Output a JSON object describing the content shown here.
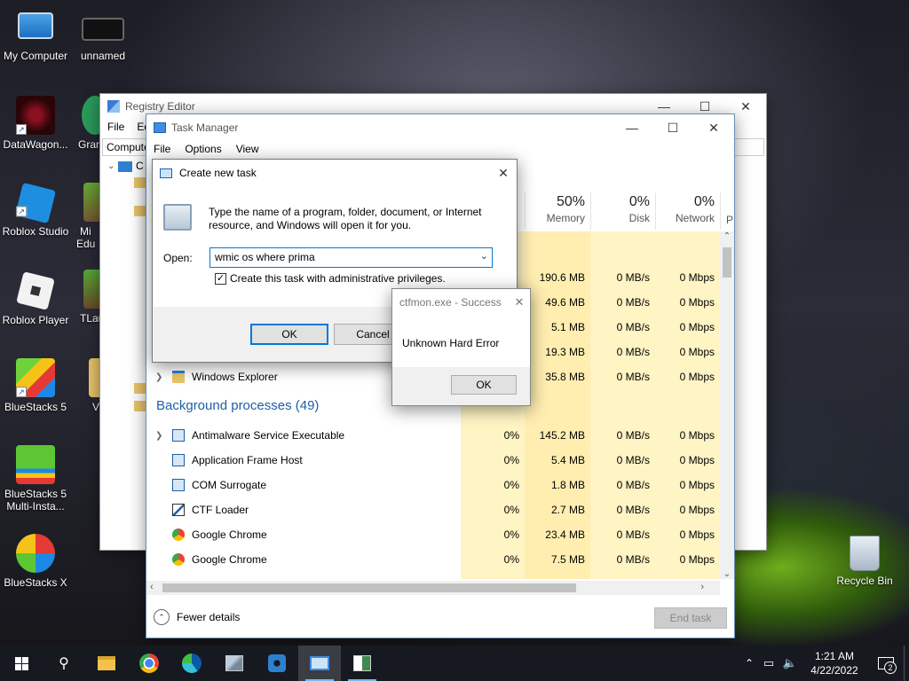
{
  "desktop": {
    "icons": [
      {
        "label": "My Computer"
      },
      {
        "label": "unnamed"
      },
      {
        "label": "DataWagon..."
      },
      {
        "label": "Grand"
      },
      {
        "label": "Roblox Studio"
      },
      {
        "label": "Mi Edu"
      },
      {
        "label": "Roblox Player"
      },
      {
        "label": "TLau"
      },
      {
        "label": "BlueStacks 5"
      },
      {
        "label": "V"
      },
      {
        "label": "BlueStacks 5 Multi-Insta..."
      },
      {
        "label": "BlueStacks X"
      },
      {
        "label": "Recycle Bin"
      }
    ]
  },
  "registry": {
    "title": "Registry Editor",
    "menu": [
      "File",
      "Ed"
    ],
    "address": "Compute",
    "tree_root": "C"
  },
  "taskmgr": {
    "title": "Task Manager",
    "menu": [
      "File",
      "Options",
      "View"
    ],
    "columns": [
      {
        "pct": "50%",
        "label": "Memory"
      },
      {
        "pct": "0%",
        "label": "Disk"
      },
      {
        "pct": "0%",
        "label": "Network"
      },
      {
        "pct": "",
        "label": "P"
      }
    ],
    "app_rows": [
      {
        "mem": "190.6 MB",
        "disk": "0 MB/s",
        "net": "0 Mbps"
      },
      {
        "mem": "49.6 MB",
        "disk": "0 MB/s",
        "net": "0 Mbps"
      },
      {
        "mem": "5.1 MB",
        "disk": "0 MB/s",
        "net": "0 Mbps"
      },
      {
        "mem": "19.3 MB",
        "disk": "0 MB/s",
        "net": "0 Mbps"
      },
      {
        "name": "Windows Explorer",
        "mem": "35.8 MB",
        "disk": "0 MB/s",
        "net": "0 Mbps"
      }
    ],
    "bg_header": "Background processes (49)",
    "bg_rows": [
      {
        "name": "Antimalware Service Executable",
        "cpu": "0%",
        "mem": "145.2 MB",
        "disk": "0 MB/s",
        "net": "0 Mbps"
      },
      {
        "name": "Application Frame Host",
        "cpu": "0%",
        "mem": "5.4 MB",
        "disk": "0 MB/s",
        "net": "0 Mbps"
      },
      {
        "name": "COM Surrogate",
        "cpu": "0%",
        "mem": "1.8 MB",
        "disk": "0 MB/s",
        "net": "0 Mbps"
      },
      {
        "name": "CTF Loader",
        "cpu": "0%",
        "mem": "2.7 MB",
        "disk": "0 MB/s",
        "net": "0 Mbps"
      },
      {
        "name": "Google Chrome",
        "cpu": "0%",
        "mem": "23.4 MB",
        "disk": "0 MB/s",
        "net": "0 Mbps"
      },
      {
        "name": "Google Chrome",
        "cpu": "0%",
        "mem": "7.5 MB",
        "disk": "0 MB/s",
        "net": "0 Mbps"
      }
    ],
    "fewer_details": "Fewer details",
    "end_task": "End task"
  },
  "run_dialog": {
    "title": "Create new task",
    "description": "Type the name of a program, folder, document, or Internet resource, and Windows will open it for you.",
    "open_label": "Open:",
    "open_value": "wmic os where prima",
    "admin_label": "Create this task with administrative privileges.",
    "admin_checked": true,
    "ok": "OK",
    "cancel": "Cancel"
  },
  "error_dialog": {
    "title": "ctfmon.exe - Success",
    "message": "Unknown Hard Error",
    "ok": "OK"
  },
  "taskbar": {
    "items": [
      "start-icon",
      "search-icon",
      "file-explorer-icon",
      "chrome-icon",
      "edge-icon",
      "app-icon",
      "settings-icon",
      "task-manager-icon",
      "registry-icon"
    ],
    "time": "1:21 AM",
    "date": "4/22/2022",
    "notification_count": "2"
  }
}
